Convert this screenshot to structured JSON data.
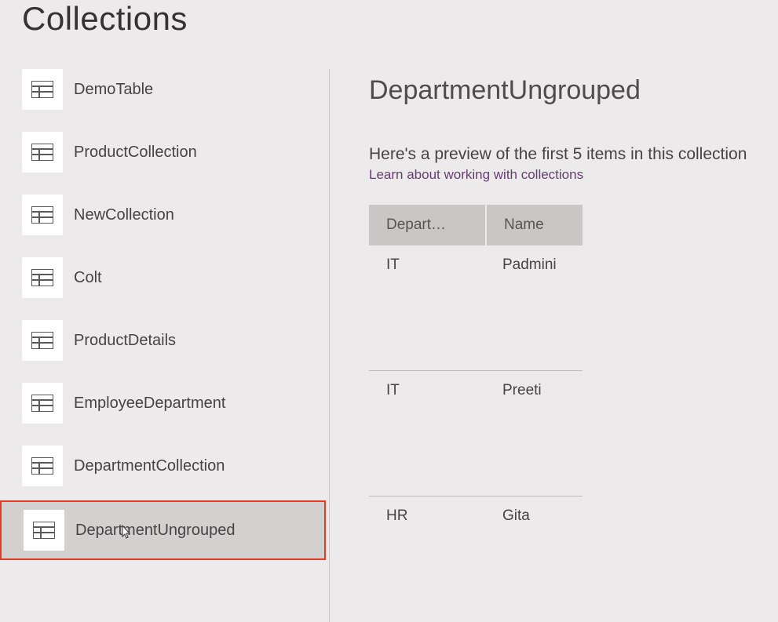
{
  "page_title": "Collections",
  "sidebar": {
    "items": [
      {
        "label": "DemoTable"
      },
      {
        "label": "ProductCollection"
      },
      {
        "label": "NewCollection"
      },
      {
        "label": "Colt"
      },
      {
        "label": "ProductDetails"
      },
      {
        "label": "EmployeeDepartment"
      },
      {
        "label": "DepartmentCollection"
      },
      {
        "label": "DepartmentUngrouped"
      }
    ]
  },
  "detail": {
    "title": "DepartmentUngrouped",
    "preview_text": "Here's a preview of the first 5 items in this collection",
    "learn_link": "Learn about working with collections",
    "columns": [
      "Depart…",
      "Name"
    ],
    "rows": [
      {
        "department": "IT",
        "name": "Padmini"
      },
      {
        "department": "IT",
        "name": "Preeti"
      },
      {
        "department": "HR",
        "name": "Gita"
      }
    ]
  }
}
